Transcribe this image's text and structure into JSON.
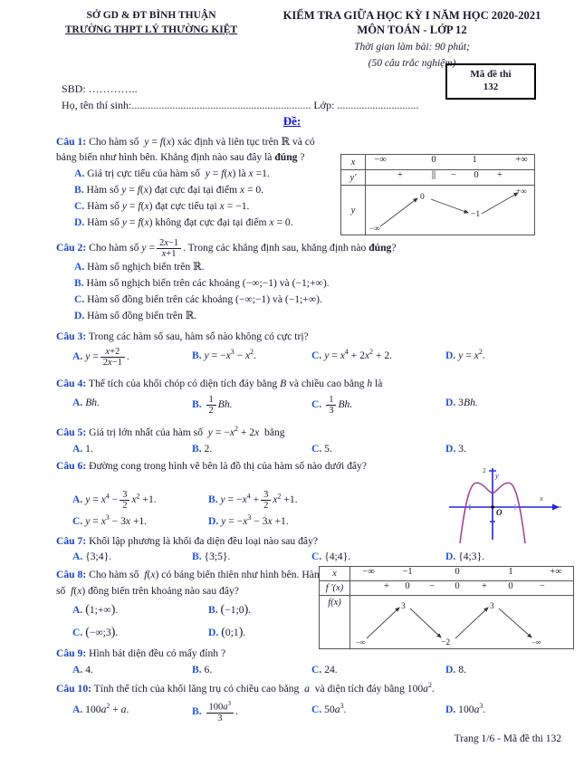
{
  "header": {
    "department": "SỞ GD & ĐT BÌNH THUẬN",
    "school": "TRƯỜNG THPT LÝ THƯỜNG KIỆT",
    "exam_title_line1": "KIỂM TRA GIỮA HỌC KỲ I NĂM HỌC 2020-2021",
    "exam_title_line2": "MÔN TOÁN - LỚP 12",
    "duration": "Thời gian làm bài: 90 phút;",
    "question_count": "(50 câu trắc nghiệm)",
    "code_label": "Mã đề thi",
    "code_value": "132",
    "sbd_label": "SBD: …………..",
    "name_label": "Họ, tên thí sinh:..................................................................",
    "class_label": "Lớp: ..............................",
    "section_title": "Đề:"
  },
  "questions": [
    {
      "num": "Câu 1:",
      "stem_html": "Cho hàm số <i>y</i> = <i>f</i>(<i>x</i>) xác định và liên tục trên ℝ và có bảng biến như hình bên. Khẳng định nào sau đây là <b>đúng</b> ?",
      "options": [
        {
          "letter": "A.",
          "html": "Giá trị cực tiểu của hàm số&nbsp; <i>y</i> = <i>f</i>(<i>x</i>) là <i>x</i> = 1."
        },
        {
          "letter": "B.",
          "html": "Hàm số <i>y</i> = <i>f</i>(<i>x</i>) đạt cực đại tại điểm <i>x</i> = 0."
        },
        {
          "letter": "C.",
          "html": "Hàm số <i>y</i> = <i>f</i>(<i>x</i>) đạt cực tiểu tại <i>x</i> = −1."
        },
        {
          "letter": "D.",
          "html": "Hàm số <i>y</i> = <i>f</i>(<i>x</i>) không đạt cực đại tại điểm <i>x</i> = 0."
        }
      ]
    },
    {
      "num": "Câu 2:",
      "stem_html": "Cho hàm số <i>y</i> = (2<i>x</i>−1)/(<i>x</i>+1). Trong các khẳng định sau, khẳng định nào <b>đúng</b>?",
      "options": [
        {
          "letter": "A.",
          "html": "Hàm số nghịch biến trên ℝ."
        },
        {
          "letter": "B.",
          "html": "Hàm số nghịch biến trên các khoảng (−∞;−1) và (−1;+∞)."
        },
        {
          "letter": "C.",
          "html": "Hàm số đồng biến trên các khoảng (−∞;−1) và (−1;+∞)."
        },
        {
          "letter": "D.",
          "html": "Hàm số đồng biến trên ℝ."
        }
      ]
    },
    {
      "num": "Câu 3:",
      "stem_html": "Trong các hàm số sau, hàm số nào không có cực trị?",
      "options": [
        {
          "letter": "A.",
          "html": "y = (x+2)/(2x−1)."
        },
        {
          "letter": "B.",
          "html": "y = −x³ − x²."
        },
        {
          "letter": "C.",
          "html": "y = x⁴ + 2x² + 2."
        },
        {
          "letter": "D.",
          "html": "y = x²."
        }
      ]
    },
    {
      "num": "Câu 4:",
      "stem_html": "Thể tích của khối chóp có diện tích đáy bằng <i>B</i> và chiều cao bằng <i>h</i> là",
      "options": [
        {
          "letter": "A.",
          "html": "Bh."
        },
        {
          "letter": "B.",
          "html": "(1/2)Bh."
        },
        {
          "letter": "C.",
          "html": "(1/3)Bh."
        },
        {
          "letter": "D.",
          "html": "3Bh."
        }
      ]
    },
    {
      "num": "Câu 5:",
      "stem_html": "Giá trị lớn nhất của hàm số <i>y</i> = −<i>x</i>² + 2<i>x</i> bằng",
      "options": [
        {
          "letter": "A.",
          "html": "1."
        },
        {
          "letter": "B.",
          "html": "2."
        },
        {
          "letter": "C.",
          "html": "5."
        },
        {
          "letter": "D.",
          "html": "3."
        }
      ]
    },
    {
      "num": "Câu 6:",
      "stem_html": "Đường cong trong hình vẽ bên là đồ thị của hàm số nào dưới đây?",
      "options": [
        {
          "letter": "A.",
          "html": "y = x⁴ − (3/2)x² + 1."
        },
        {
          "letter": "B.",
          "html": "y = −x⁴ + (3/2)x² + 1."
        },
        {
          "letter": "C.",
          "html": "y = x³ − 3x + 1."
        },
        {
          "letter": "D.",
          "html": "y = −x³ − 3x + 1."
        }
      ]
    },
    {
      "num": "Câu 7:",
      "stem_html": "Khối lập phương là khối đa diện đều loại nào sau đây?",
      "options": [
        {
          "letter": "A.",
          "html": "{3;4}."
        },
        {
          "letter": "B.",
          "html": "{3;5}."
        },
        {
          "letter": "C.",
          "html": "{4;4}."
        },
        {
          "letter": "D.",
          "html": "{4;3}."
        }
      ]
    },
    {
      "num": "Câu 8:",
      "stem_html": "Cho hàm số <i>f</i>(<i>x</i>) có bảng biến thiên như hình bên. Hàm số <i>f</i>(<i>x</i>) đồng biến trên khoảng nào sau đây?",
      "options": [
        {
          "letter": "A.",
          "html": "(1;+∞)."
        },
        {
          "letter": "B.",
          "html": "(−1;0)."
        },
        {
          "letter": "C.",
          "html": "(−∞;3)."
        },
        {
          "letter": "D.",
          "html": "(0;1)."
        }
      ]
    },
    {
      "num": "Câu 9:",
      "stem_html": "Hình bát diện đều có mấy đỉnh ?",
      "options": [
        {
          "letter": "A.",
          "html": "4."
        },
        {
          "letter": "B.",
          "html": "6."
        },
        {
          "letter": "C.",
          "html": "24."
        },
        {
          "letter": "D.",
          "html": "8."
        }
      ]
    },
    {
      "num": "Câu 10:",
      "stem_html": "Tính thể tích của khối lăng trụ có chiều cao bằng <i>a</i> và diện tích đáy bằng 100<i>a</i>².",
      "options": [
        {
          "letter": "A.",
          "html": "100a² + a."
        },
        {
          "letter": "B.",
          "html": "100a³/3."
        },
        {
          "letter": "C.",
          "html": "50a³."
        },
        {
          "letter": "D.",
          "html": "100a³."
        }
      ]
    }
  ],
  "variation_table_1": {
    "row_labels": [
      "x",
      "y'"
    ],
    "value_row_label": "y",
    "x_values": [
      "−∞",
      "0",
      "1",
      "+∞"
    ],
    "yprime_values": [
      "+",
      "∥",
      "−",
      "0",
      "+"
    ],
    "y_values": [
      "−∞",
      "0",
      "−1",
      "+∞"
    ],
    "trend": "increase-decrease-increase"
  },
  "variation_table_2": {
    "row_labels": [
      "x",
      "f '(x)"
    ],
    "value_row_label": "f(x)",
    "x_values": [
      "−∞",
      "−1",
      "0",
      "1",
      "+∞"
    ],
    "fprime_values": [
      "+",
      "0",
      "−",
      "0",
      "+",
      "0",
      "−"
    ],
    "f_values": [
      "−∞",
      "3",
      "−2",
      "3",
      "−∞"
    ],
    "trend": "up-down-up-down"
  },
  "figure_q6": {
    "curve_label": "quartic-downward",
    "axis_x_label": "x",
    "axis_y_label": "y",
    "origin_label": "O",
    "y_tick_label": "2",
    "curve_color": "#9b3f9b",
    "axis_color": "#2222dd"
  },
  "footer": {
    "text": "Trang 1/6 - Mã đề thi 132"
  }
}
